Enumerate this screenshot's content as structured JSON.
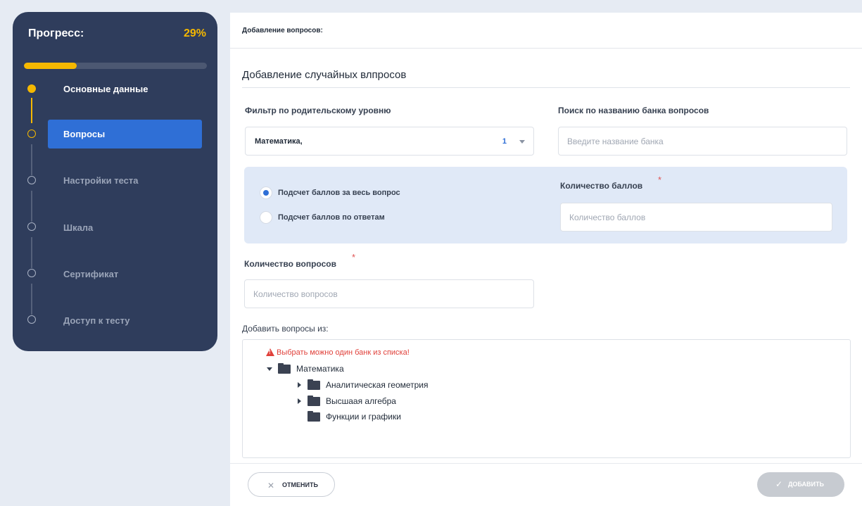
{
  "sidebar": {
    "progress_title": "Прогресс:",
    "progress_percent": "29%",
    "progress_value": 0.29,
    "steps": [
      {
        "label": "Основные данные",
        "state": "done"
      },
      {
        "label": "Вопросы",
        "state": "current"
      },
      {
        "label": "Настройки теста",
        "state": "pending"
      },
      {
        "label": "Шкала",
        "state": "pending"
      },
      {
        "label": "Сертификат",
        "state": "pending"
      },
      {
        "label": "Доступ к тесту",
        "state": "pending"
      }
    ]
  },
  "main": {
    "header": "Добавление вопросов:",
    "section_title": "Добавление случайных влпросов",
    "filter": {
      "label": "Фильтр по родительскому уровню",
      "value": "Математика,",
      "count": "1"
    },
    "search": {
      "label": "Поиск по названию банка вопросов",
      "placeholder": "Введите название банка"
    },
    "scoring": {
      "options": [
        {
          "label": "Подсчет баллов за весь вопрос",
          "checked": true
        },
        {
          "label": "Подсчет баллов по ответам",
          "checked": false
        }
      ],
      "points_label": "Количество баллов",
      "points_placeholder": "Количество баллов",
      "required_mark": "*"
    },
    "questions_count": {
      "label": "Количество вопросов",
      "placeholder": "Количество вопросов",
      "required_mark": "*"
    },
    "add_from": {
      "label": "Добавить вопросы из:",
      "warning": "Выбрать можно один банк из списка!",
      "tree": [
        {
          "label": "Математика",
          "level": 0,
          "expander": "expanded"
        },
        {
          "label": "Аналитическая геометрия",
          "level": 1,
          "expander": "collapsed"
        },
        {
          "label": "Высшаая алгебра",
          "level": 1,
          "expander": "collapsed"
        },
        {
          "label": "Функции и графики",
          "level": 1,
          "expander": "none"
        }
      ]
    },
    "footer": {
      "cancel_label": "ОТМЕНИТЬ",
      "add_label": "ДОБАВИТЬ"
    }
  },
  "colors": {
    "sidebar_bg": "#2f3d5c",
    "accent_yellow": "#f5b800",
    "accent_blue": "#2f6fd6",
    "warning_red": "#e0403a"
  },
  "icons": {
    "cancel": "close-icon",
    "add": "check-icon",
    "warning": "warning-icon",
    "folder": "folder-icon"
  }
}
